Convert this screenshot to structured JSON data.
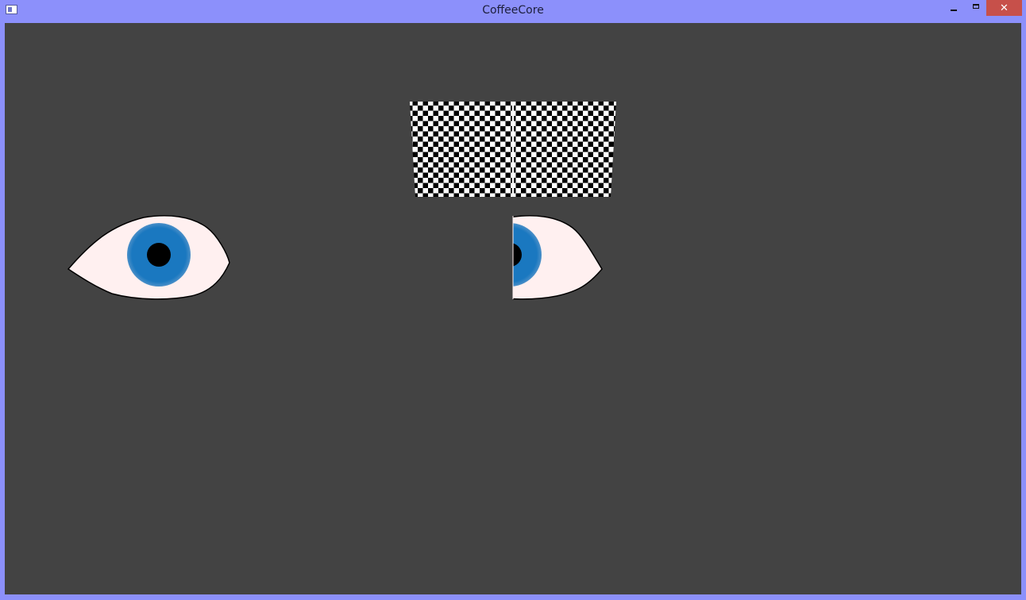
{
  "window": {
    "title": "CoffeeCore",
    "close_symbol": "✕",
    "icons": {
      "app": "app-window-icon",
      "minimize": "minimize-icon",
      "maximize": "maximize-icon",
      "close": "close-icon"
    },
    "colors": {
      "frame": "#8c90fb",
      "close_button": "#c7504a",
      "client_background": "#434343"
    }
  },
  "scene": {
    "colors": {
      "sclera": "#fff0f0",
      "iris": "#1a78c0",
      "pupil": "#000000",
      "checker_dark": "#000000",
      "checker_light": "#ffffff"
    }
  }
}
